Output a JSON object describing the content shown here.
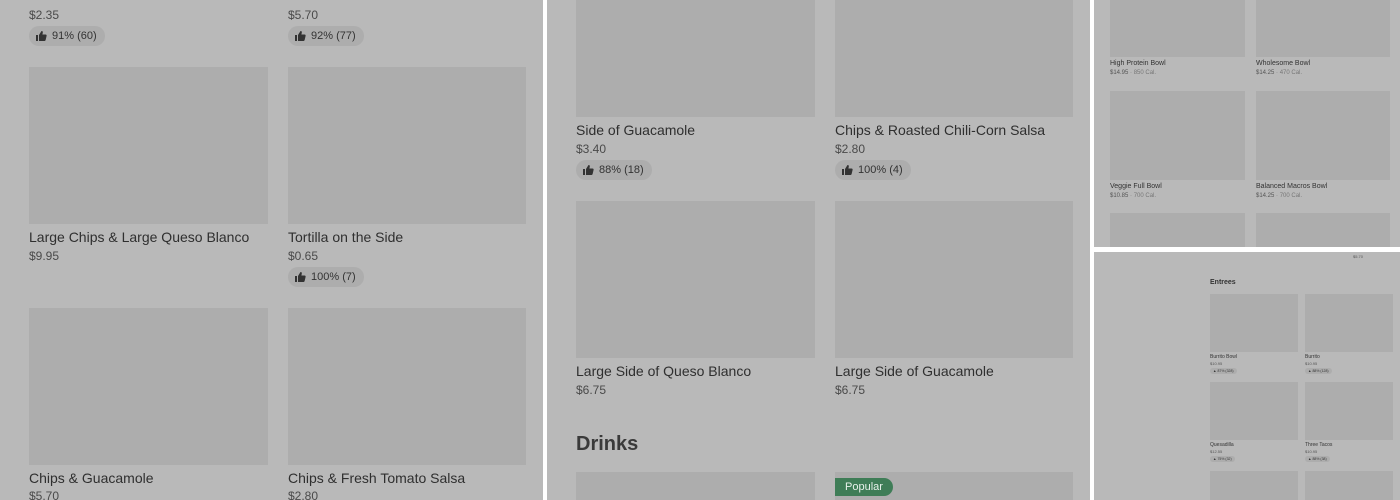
{
  "panel1": {
    "top_prices": [
      "$2.35",
      "$5.70"
    ],
    "top_ratings": [
      "91% (60)",
      "92% (77)"
    ],
    "items": [
      {
        "name": "Large Chips & Large Queso Blanco",
        "price": "$9.95",
        "rating": ""
      },
      {
        "name": "Tortilla on the Side",
        "price": "$0.65",
        "rating": "100% (7)"
      },
      {
        "name": "Chips & Guacamole",
        "price": "$5.70",
        "rating": ""
      },
      {
        "name": "Chips & Fresh Tomato Salsa",
        "price": "$2.80",
        "rating": ""
      }
    ]
  },
  "panel2": {
    "items": [
      {
        "name": "Side of Guacamole",
        "price": "$3.40",
        "rating": "88% (18)"
      },
      {
        "name": "Chips & Roasted Chili-Corn Salsa",
        "price": "$2.80",
        "rating": "100% (4)"
      },
      {
        "name": "Large Side of Queso Blanco",
        "price": "$6.75",
        "rating": ""
      },
      {
        "name": "Large Side of Guacamole",
        "price": "$6.75",
        "rating": ""
      }
    ],
    "section_title": "Drinks",
    "popular_badge": "Popular"
  },
  "panel3": {
    "items": [
      {
        "name": "High Protein Bowl",
        "price": "$14.95",
        "cal": "850 Cal."
      },
      {
        "name": "Wholesome Bowl",
        "price": "$14.25",
        "cal": "470 Cal."
      },
      {
        "name": "Veggie Full Bowl",
        "price": "$10.85",
        "cal": "700 Cal."
      },
      {
        "name": "Balanced Macros Bowl",
        "price": "$14.25",
        "cal": "700 Cal."
      }
    ],
    "separator": " · "
  },
  "panel4": {
    "top_price": "$5.70",
    "section_title": "Entrees",
    "items": [
      {
        "name": "Burrito Bowl",
        "price": "$10.95",
        "rating": "87% (328)"
      },
      {
        "name": "Burrito",
        "price": "$10.95",
        "rating": "88% (128)"
      },
      {
        "name": "Quesadilla",
        "price": "$12.55",
        "rating": "75% (32)"
      },
      {
        "name": "Three Tacos",
        "price": "$10.95",
        "rating": "88% (38)"
      }
    ]
  },
  "colors": {
    "overlay_gray": "#b9b9b9",
    "placeholder_gray": "#adadad",
    "popular_green": "#3f7d57"
  },
  "icons": {
    "rating": "thumbs-up-icon"
  }
}
